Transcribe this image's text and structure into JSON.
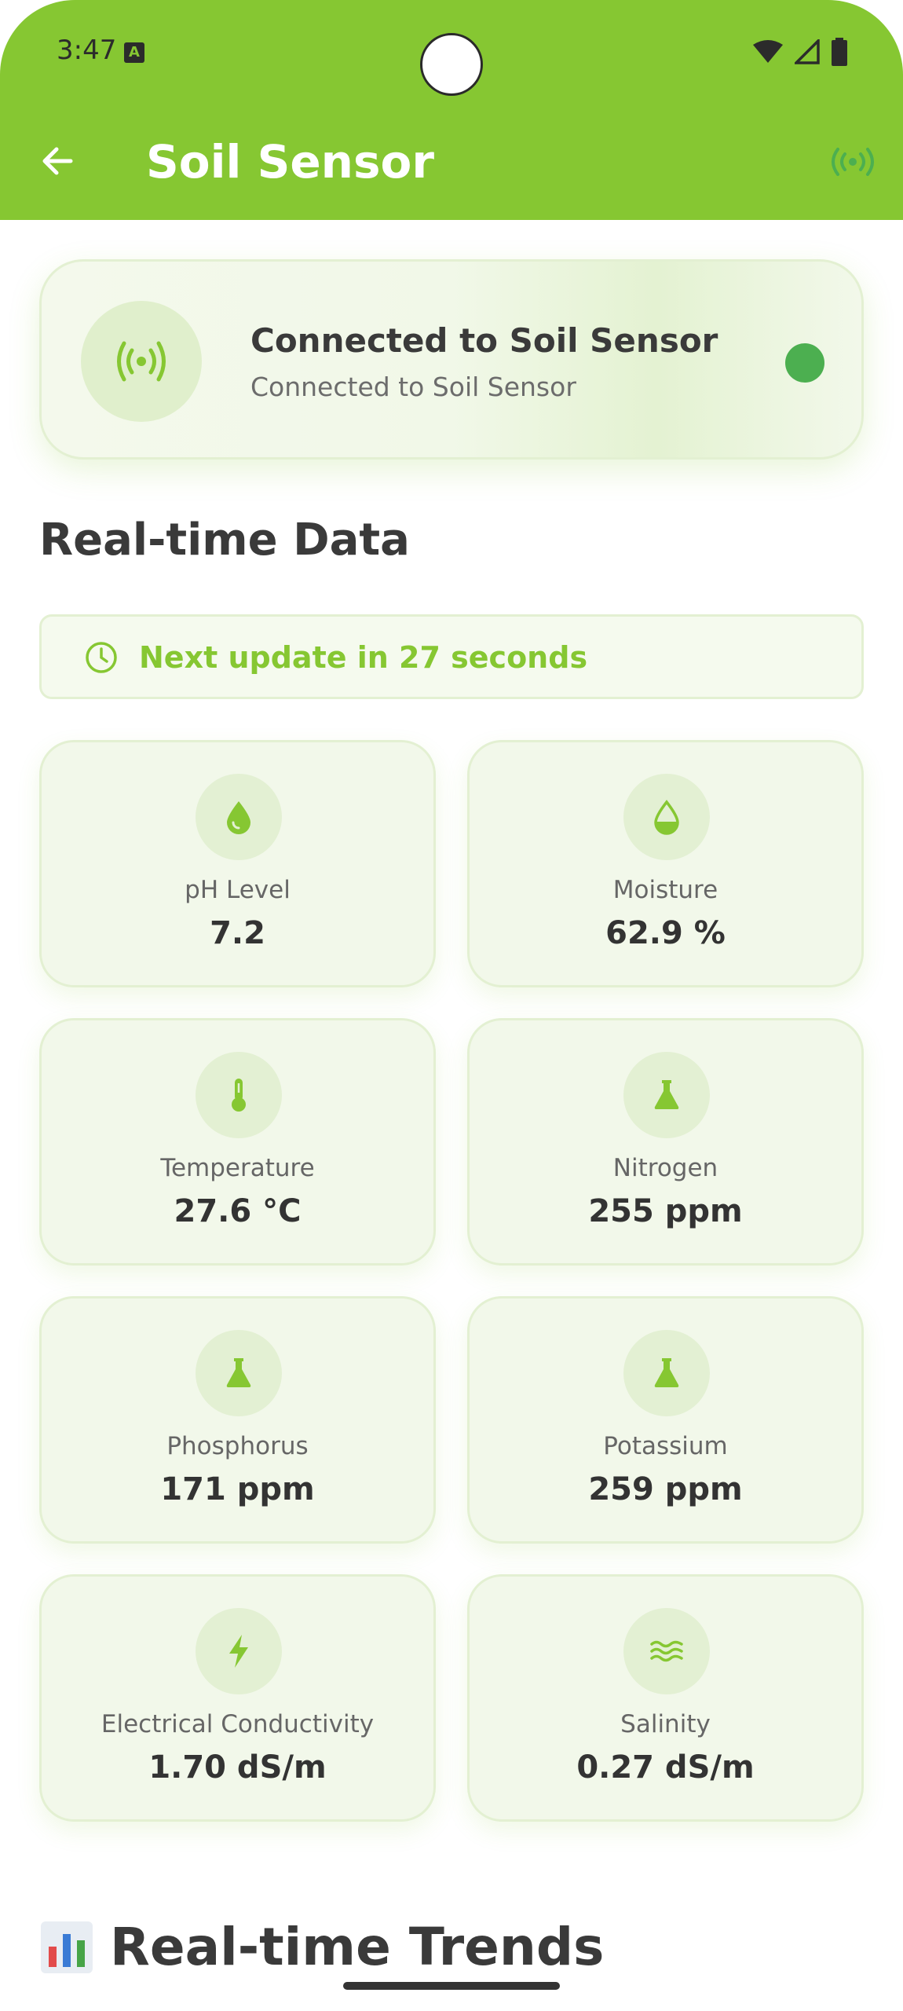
{
  "status_bar": {
    "time": "3:47",
    "notification_letter": "A"
  },
  "app_bar": {
    "title": "Soil Sensor"
  },
  "connection": {
    "title": "Connected to Soil Sensor",
    "subtitle": "Connected to Soil Sensor",
    "status_color": "#4caf50"
  },
  "realtime": {
    "title": "Real-time Data",
    "next_update": "Next update in 27 seconds"
  },
  "metrics": [
    {
      "label": "pH Level",
      "value": "7.2",
      "icon": "droplet-icon"
    },
    {
      "label": "Moisture",
      "value": "62.9 %",
      "icon": "half-droplet-icon"
    },
    {
      "label": "Temperature",
      "value": "27.6 °C",
      "icon": "thermometer-icon"
    },
    {
      "label": "Nitrogen",
      "value": "255 ppm",
      "icon": "flask-icon"
    },
    {
      "label": "Phosphorus",
      "value": "171 ppm",
      "icon": "flask-icon"
    },
    {
      "label": "Potassium",
      "value": "259 ppm",
      "icon": "flask-icon"
    },
    {
      "label": "Electrical Conductivity",
      "value": "1.70 dS/m",
      "icon": "lightning-icon"
    },
    {
      "label": "Salinity",
      "value": "0.27 dS/m",
      "icon": "waves-icon"
    }
  ],
  "trends": {
    "title": "Real-time Trends"
  },
  "colors": {
    "accent": "#86c732",
    "card_bg": "#f2f8ea",
    "status_green": "#4caf50"
  }
}
